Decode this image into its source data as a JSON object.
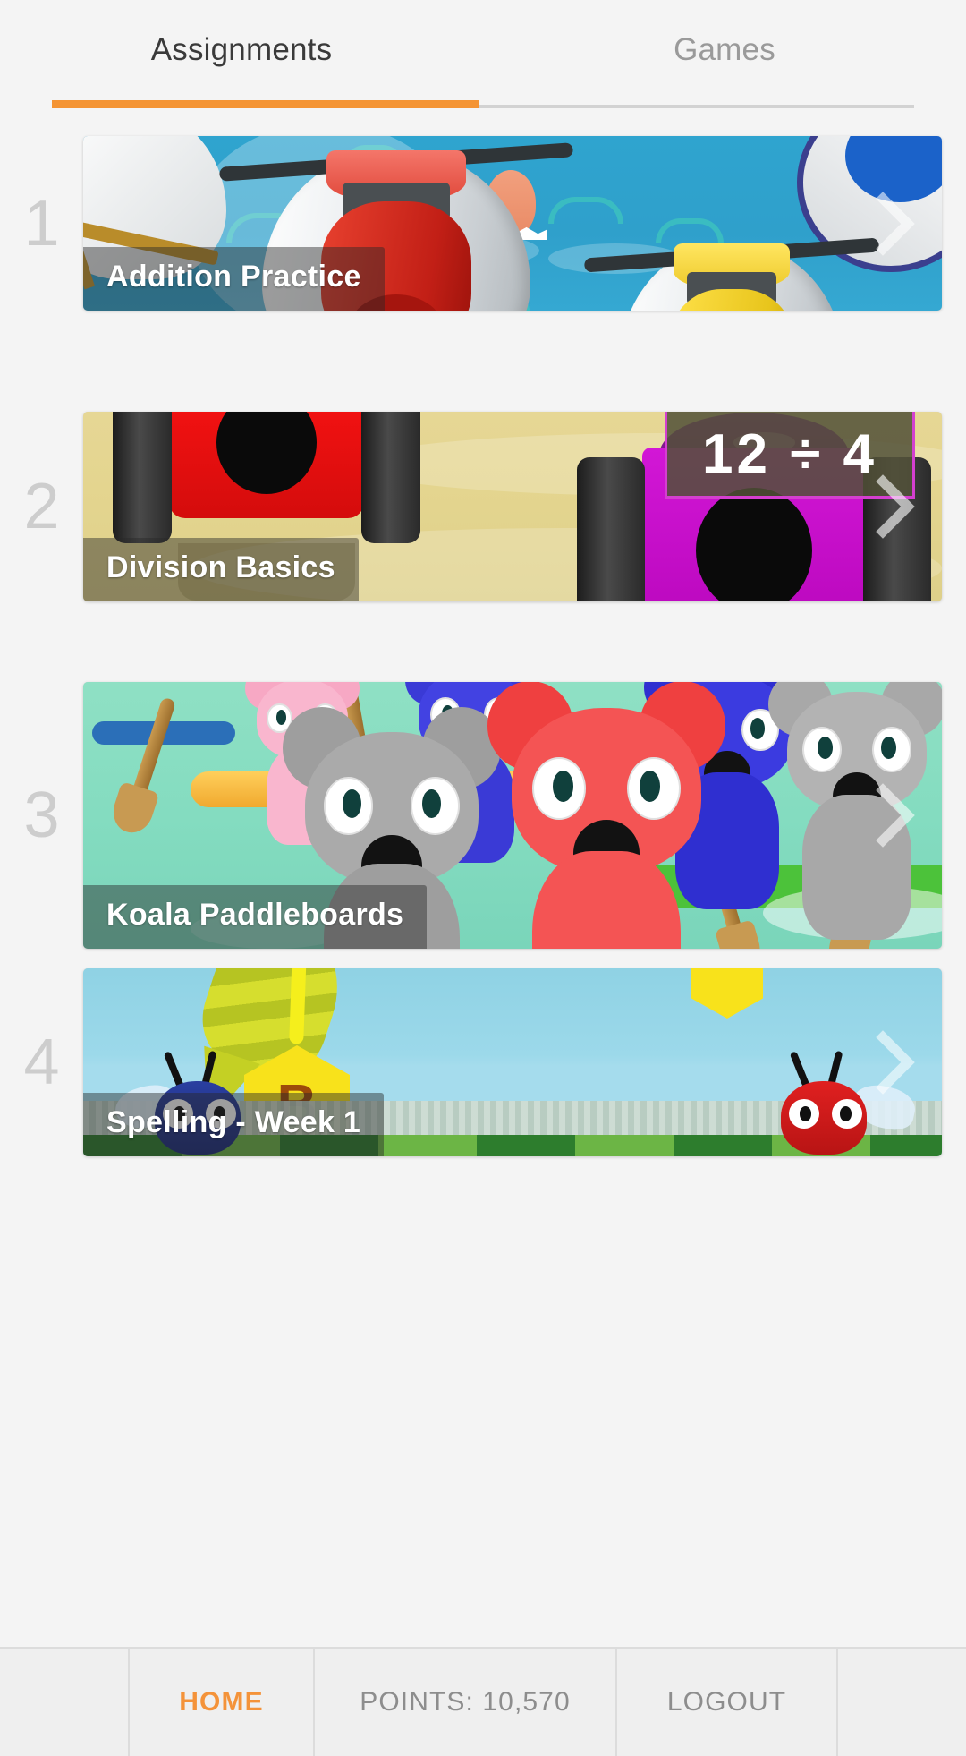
{
  "tabs": [
    {
      "label": "Assignments",
      "active": true
    },
    {
      "label": "Games",
      "active": false
    }
  ],
  "accent_color": "#f4933a",
  "assignments": [
    {
      "number": "1",
      "title": "Addition Practice",
      "art": "jetski-water-race",
      "chevron": "chevron-right-icon"
    },
    {
      "number": "2",
      "title": "Division Basics",
      "art": "desert-buggy-race",
      "problem": "12 ÷ 4",
      "chevron": "chevron-right-icon"
    },
    {
      "number": "3",
      "title": "Koala Paddleboards",
      "art": "koala-paddleboard-race",
      "chevron": "chevron-right-icon"
    },
    {
      "number": "4",
      "title": "Spelling - Week 1",
      "art": "spelling-bee-field",
      "letter": "B",
      "chevron": "chevron-right-icon"
    }
  ],
  "bottom_bar": {
    "home_label": "HOME",
    "points_label": "POINTS: 10,570",
    "logout_label": "LOGOUT"
  }
}
